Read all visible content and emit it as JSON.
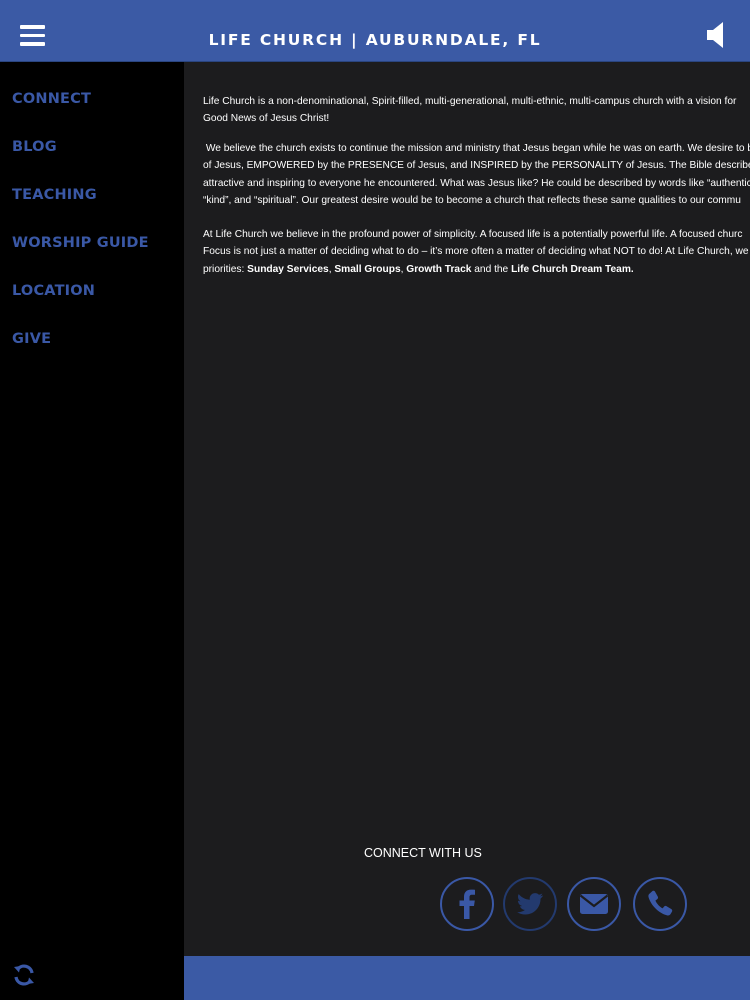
{
  "header": {
    "title": "LIFE CHURCH | AUBURNDALE, FL",
    "menu_icon": "hamburger-menu-icon",
    "speaker_icon": "speaker-icon"
  },
  "sidebar": {
    "items": [
      {
        "label": "CONNECT"
      },
      {
        "label": "BLOG"
      },
      {
        "label": "TEACHING"
      },
      {
        "label": "WORSHIP GUIDE"
      },
      {
        "label": "LOCATION"
      },
      {
        "label": "GIVE"
      }
    ],
    "refresh_icon": "refresh-icon"
  },
  "content": {
    "p1_line1": "Life Church is a non-denominational, Spirit-filled, multi-generational, multi-ethnic, multi-campus church with a vision for",
    "p1_line2": "Good News of Jesus Christ!",
    "p2_line1": " We believe the church exists to continue the mission and ministry that Jesus began while he was on earth. We desire to b",
    "p2_line2": "of Jesus, EMPOWERED by the PRESENCE of Jesus, and INSPIRED by the PERSONALITY of Jesus. The Bible describes Jesus a",
    "p2_line3": "attractive and inspiring to everyone he encountered. What was Jesus like? He could be described by words like “authentic",
    "p2_line4": "“kind”, and “spiritual”. Our greatest desire would be to become a church that reflects these same qualities to our commu",
    "p3_line1": "At Life Church we believe in the profound power of simplicity. A focused life is a potentially powerful life. A focused churc",
    "p3_line2": "Focus is not just a matter of deciding what to do – it’s more often a matter of deciding what NOT to do! At Life Church, we",
    "p3_line3_prefix": "priorities: ",
    "priority1": "Sunday Services",
    "sep1": ", ",
    "priority2": "Small Groups",
    "sep2": ", ",
    "priority3": "Growth Track",
    "sep3": " and the ",
    "priority4": "Life Church Dream Team."
  },
  "connect": {
    "label": "CONNECT WITH US",
    "icons": [
      "facebook-icon",
      "twitter-icon",
      "email-icon",
      "phone-icon"
    ]
  },
  "colors": {
    "brand_blue": "#3b5aa5",
    "nav_blue": "#3a58a6",
    "content_bg": "#1c1c1e",
    "sidebar_bg": "#000000"
  }
}
